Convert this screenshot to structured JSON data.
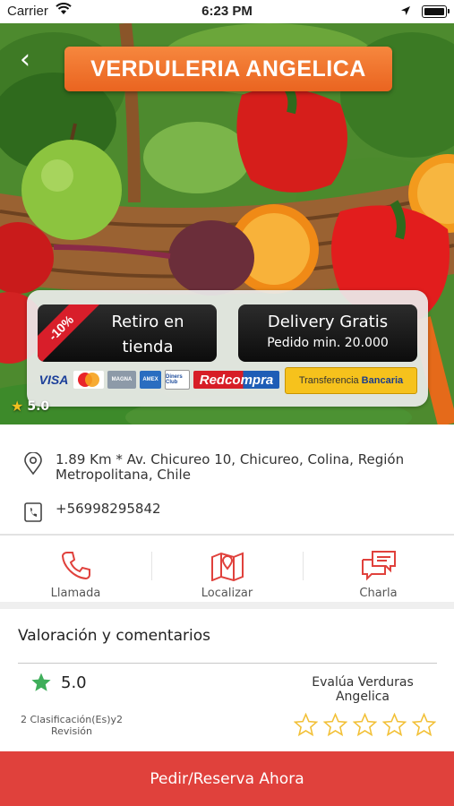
{
  "status_bar": {
    "carrier": "Carrier",
    "time": "6:23 PM"
  },
  "store": {
    "name": "VERDULERIA ANGELICA",
    "rating": "5.0",
    "address": "1.89 Km * Av. Chicureo 10, Chicureo, Colina, Región Metropolitana, Chile",
    "phone": "+56998295842"
  },
  "promo": {
    "discount": "-10%",
    "pickup_label": "Retiro en tienda",
    "delivery_title": "Delivery Gratis",
    "delivery_min": "Pedido min. 20.000",
    "payments": {
      "visa": "VISA",
      "magna": "MAGNA",
      "amex": "AMEX",
      "diners": "Diners Club",
      "redcompra_red": "Red",
      "redcompra_compra": "compra",
      "transfer_a": "Transferencia",
      "transfer_b": "Bancaria"
    }
  },
  "actions": [
    {
      "label": "Llamada",
      "icon": "phone-icon"
    },
    {
      "label": "Localizar",
      "icon": "map-icon"
    },
    {
      "label": "Charla",
      "icon": "chat-icon"
    }
  ],
  "ratings": {
    "title": "Valoración y comentarios",
    "score": "5.0",
    "count_text": "2 Clasificación(Es)y2 Revisión",
    "evaluate_text": "Evalúa Verduras Angelica"
  },
  "cta_label": "Pedir/Reserva Ahora",
  "colors": {
    "accent": "#e0413c",
    "banner": "#f07a33",
    "star_green": "#3fae5a",
    "star_outline": "#f2c037"
  }
}
